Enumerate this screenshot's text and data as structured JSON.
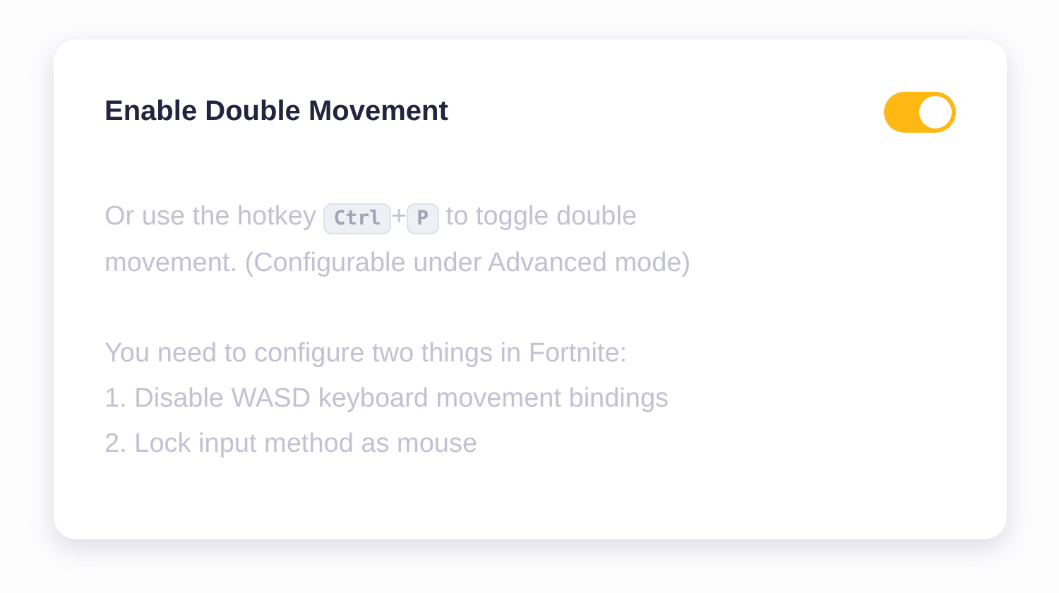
{
  "setting": {
    "title": "Enable Double Movement",
    "on": true,
    "hint": {
      "before": "Or use the hotkey",
      "keys": [
        "Ctrl",
        "P"
      ],
      "separator": "+",
      "after": [
        "to toggle double",
        "movement. (Configurable under Advanced mode)"
      ]
    },
    "notes": [
      "You need to configure two things in Fortnite:",
      "1. Disable WASD keyboard movement bindings",
      "2. Lock input method as mouse"
    ]
  }
}
